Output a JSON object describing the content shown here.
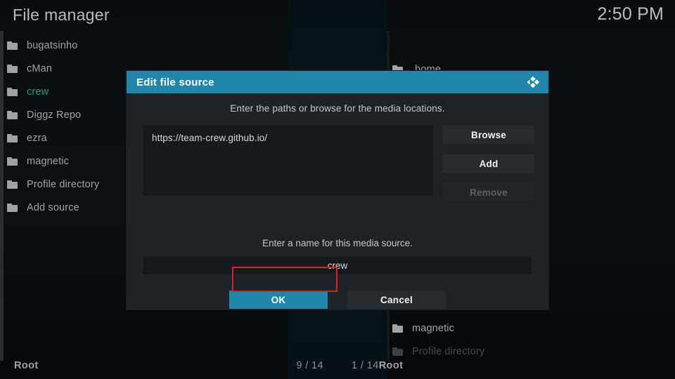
{
  "header": {
    "title": "File manager",
    "clock": "2:50 PM"
  },
  "left_panel": {
    "items": [
      {
        "label": "bugatsinho",
        "icon": "folder-icon",
        "state": "normal"
      },
      {
        "label": "cMan",
        "icon": "folder-icon",
        "state": "normal"
      },
      {
        "label": "crew",
        "icon": "folder-icon",
        "state": "selected"
      },
      {
        "label": "Diggz Repo",
        "icon": "folder-icon",
        "state": "normal"
      },
      {
        "label": "ezra",
        "icon": "folder-icon",
        "state": "normal"
      },
      {
        "label": "magnetic",
        "icon": "folder-icon",
        "state": "normal"
      },
      {
        "label": "Profile directory",
        "icon": "folder-icon",
        "state": "normal"
      },
      {
        "label": "Add source",
        "icon": "folder-icon",
        "state": "normal"
      }
    ],
    "status_path": "Root",
    "status_count": "9 / 14"
  },
  "right_panel": {
    "items": [
      {
        "label": ".home",
        "icon": "folder-icon",
        "state": "normal"
      },
      {
        "label": "magnetic",
        "icon": "folder-icon",
        "state": "normal"
      },
      {
        "label": "Profile directory",
        "icon": "folder-icon",
        "state": "dim"
      }
    ],
    "status_path": "Root",
    "status_count": "1 / 14"
  },
  "dialog": {
    "title": "Edit file source",
    "logo_icon": "kodi-logo-icon",
    "paths_hint": "Enter the paths or browse for the media locations.",
    "path_value": "https://team-crew.github.io/",
    "buttons": {
      "browse": "Browse",
      "add": "Add",
      "remove": "Remove"
    },
    "name_hint": "Enter a name for this media source.",
    "name_value": "crew",
    "ok_label": "OK",
    "cancel_label": "Cancel"
  },
  "colors": {
    "accent": "#2087ab",
    "selected_item": "#2f9c6e",
    "focus_ring": "#e02020",
    "dialog_bg": "#1e2327",
    "text": "#9fa4a7"
  }
}
